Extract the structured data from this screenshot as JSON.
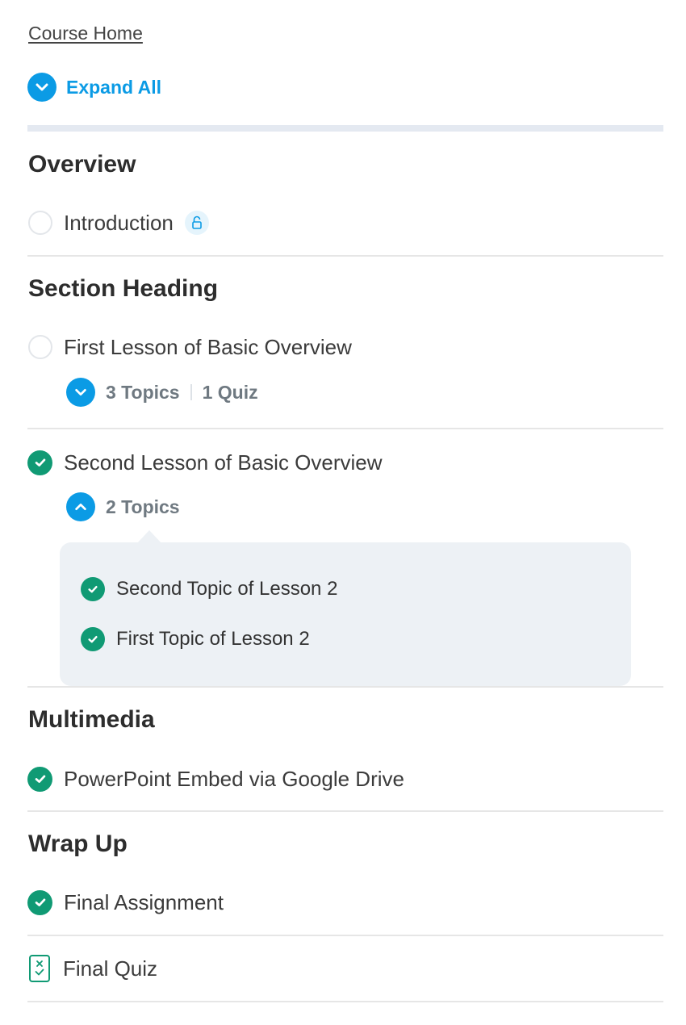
{
  "nav": {
    "course_home": "Course Home",
    "expand_all": "Expand All"
  },
  "sections": [
    {
      "heading": "Overview",
      "items": [
        {
          "title": "Introduction",
          "status": "not-started",
          "badge_icon": "lock-open-icon"
        }
      ]
    },
    {
      "heading": "Section Heading",
      "items": [
        {
          "title": "First Lesson of Basic Overview",
          "status": "not-started",
          "meta": {
            "topics": "3 Topics",
            "quiz": "1 Quiz",
            "expanded": false
          }
        },
        {
          "title": "Second Lesson of Basic Overview",
          "status": "complete",
          "meta": {
            "topics": "2 Topics",
            "expanded": true
          },
          "topics": [
            {
              "title": "Second Topic of Lesson 2",
              "status": "complete"
            },
            {
              "title": "First Topic of Lesson 2",
              "status": "complete"
            }
          ]
        }
      ]
    },
    {
      "heading": "Multimedia",
      "items": [
        {
          "title": "PowerPoint Embed via Google Drive",
          "status": "complete"
        }
      ]
    },
    {
      "heading": "Wrap Up",
      "items": [
        {
          "title": "Final Assignment",
          "status": "complete"
        },
        {
          "title": "Final Quiz",
          "status": "quiz",
          "icon": "quiz-icon"
        }
      ]
    }
  ],
  "colors": {
    "accent": "#0b9be5",
    "complete": "#109a74",
    "muted": "#6f7981"
  }
}
